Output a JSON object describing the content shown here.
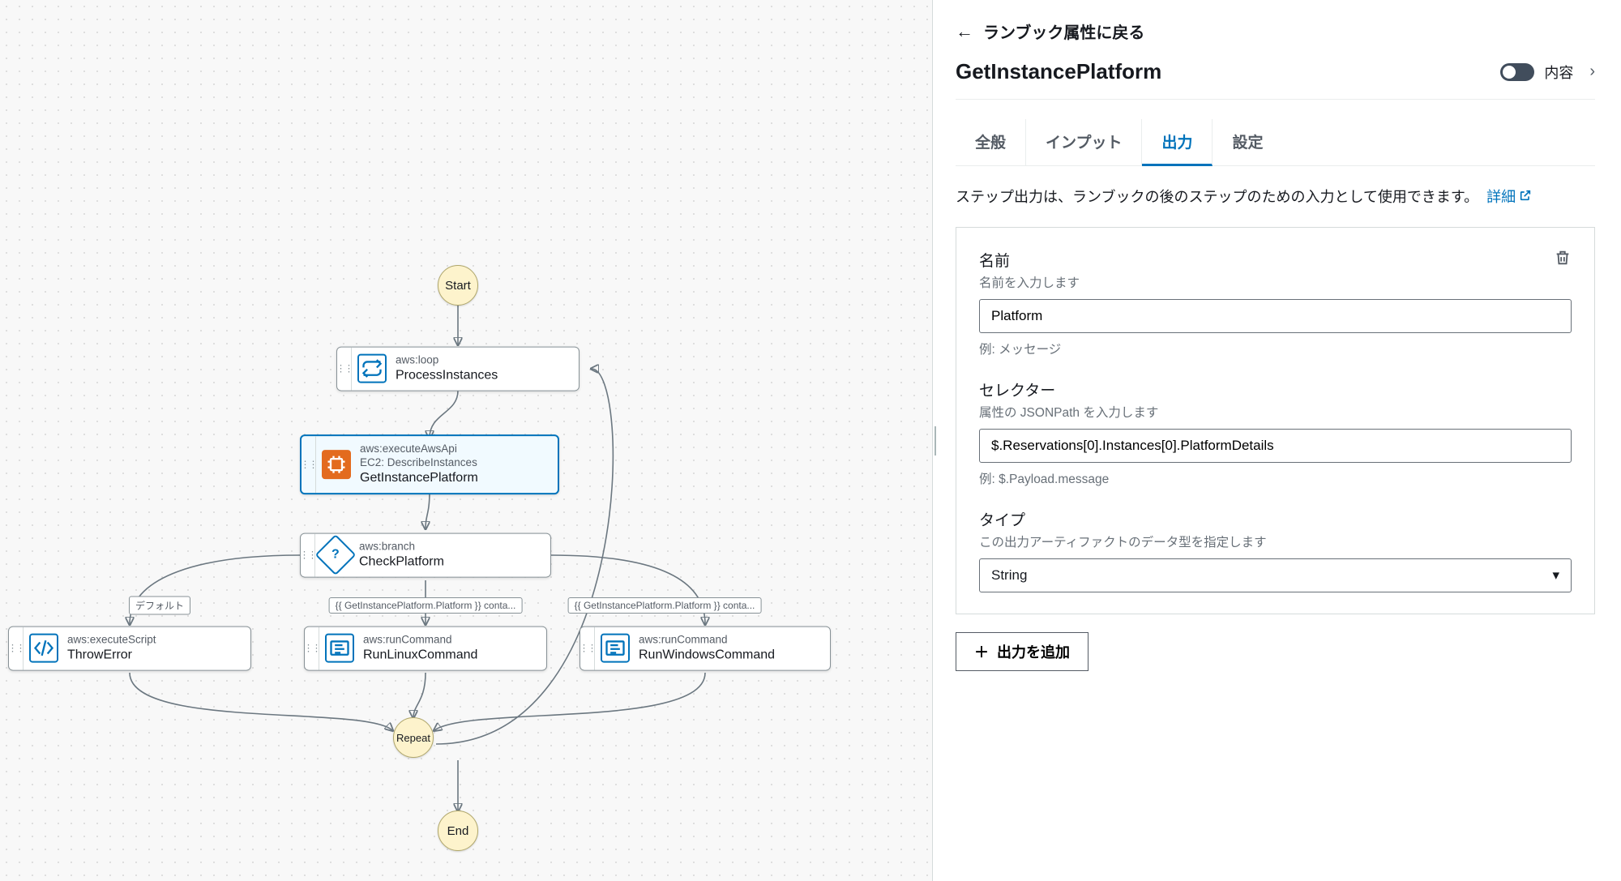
{
  "canvas": {
    "start_label": "Start",
    "repeat_label": "Repeat",
    "end_label": "End",
    "default_edge_label": "デフォルト",
    "cond_label_linux": "{{ GetInstancePlatform.Platform }} conta...",
    "cond_label_windows": "{{ GetInstancePlatform.Platform }} conta...",
    "nodes": {
      "process_instances": {
        "action": "aws:loop",
        "name": "ProcessInstances"
      },
      "get_instance_platform": {
        "action": "aws:executeAwsApi",
        "subtitle": "EC2: DescribeInstances",
        "name": "GetInstancePlatform"
      },
      "check_platform": {
        "action": "aws:branch",
        "name": "CheckPlatform"
      },
      "throw_error": {
        "action": "aws:executeScript",
        "name": "ThrowError"
      },
      "run_linux": {
        "action": "aws:runCommand",
        "name": "RunLinuxCommand"
      },
      "run_windows": {
        "action": "aws:runCommand",
        "name": "RunWindowsCommand"
      }
    }
  },
  "sidebar": {
    "back_label": "ランブック属性に戻る",
    "title": "GetInstancePlatform",
    "toggle_label": "内容",
    "tabs": {
      "general": "全般",
      "inputs": "インプット",
      "outputs": "出力",
      "settings": "設定"
    },
    "intro_text": "ステップ出力は、ランブックの後のステップのための入力として使用できます。",
    "intro_link": "詳細",
    "fields": {
      "name": {
        "label": "名前",
        "help": "名前を入力します",
        "value": "Platform",
        "hint": "例: メッセージ"
      },
      "selector": {
        "label": "セレクター",
        "help": "属性の JSONPath を入力します",
        "value": "$.Reservations[0].Instances[0].PlatformDetails",
        "hint": "例: $.Payload.message"
      },
      "type": {
        "label": "タイプ",
        "help": "この出力アーティファクトのデータ型を指定します",
        "value": "String"
      }
    },
    "add_button": "出力を追加"
  }
}
